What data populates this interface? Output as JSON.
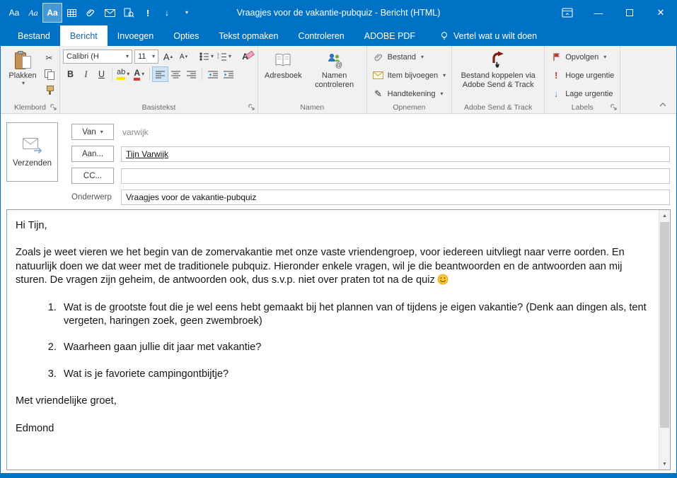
{
  "colors": {
    "accent": "#0072c6",
    "high_urgency_red": "#c0392b",
    "low_urgency_blue": "#2b7cd3",
    "highlight_yellow": "#ffe114",
    "font_color_red": "#d83b2d"
  },
  "titlebar": {
    "title": "Vraagjes voor de vakantie-pubquiz - Bericht (HTML)",
    "qat_aa": [
      "Aa",
      "Aa",
      "Aa"
    ]
  },
  "icons": {
    "dropdown": "▾",
    "up_triangle": "▴",
    "down_triangle": "▾",
    "scissors": "✂",
    "pen": "✎",
    "high": "!",
    "low": "↓",
    "minimize": "—",
    "close": "✕",
    "scroll_up": "▲",
    "scroll_down": "▼",
    "emoji": "😊"
  },
  "tabs": {
    "file": "Bestand",
    "items": [
      "Bericht",
      "Invoegen",
      "Opties",
      "Tekst opmaken",
      "Controleren",
      "ADOBE PDF"
    ],
    "active": "Bericht",
    "tellme": "Vertel wat u wilt doen"
  },
  "ribbon": {
    "clipboard": {
      "paste": "Plakken",
      "group": "Klembord"
    },
    "basic_text": {
      "font_name": "Calibri (H",
      "font_size": "11",
      "grow": "A",
      "shrink": "A",
      "bold": "B",
      "italic": "I",
      "underline": "U",
      "highlight": "ab",
      "font_color": "A",
      "clear": "A",
      "group": "Basistekst"
    },
    "names": {
      "address_book": "Adresboek",
      "check_names": "Namen controleren",
      "group": "Namen"
    },
    "include": {
      "attach_file": "Bestand",
      "attach_item": "Item bijvoegen",
      "signature": "Handtekening",
      "group": "Opnemen"
    },
    "adobe": {
      "button": "Bestand koppelen via Adobe Send & Track",
      "group": "Adobe Send & Track"
    },
    "tags": {
      "follow_up": "Opvolgen",
      "high": "Hoge urgentie",
      "low": "Lage urgentie",
      "group": "Labels"
    }
  },
  "header": {
    "send": "Verzenden",
    "from_button": "Van",
    "from_value": "varwijk",
    "to_button": "Aan...",
    "to_value": "Tijn Varwijk",
    "cc_button": "CC...",
    "cc_value": "",
    "subject_label": "Onderwerp",
    "subject_value": "Vraagjes voor de vakantie-pubquiz"
  },
  "message": {
    "greeting": "Hi Tijn,",
    "para1": "Zoals je weet vieren we het begin van de zomervakantie met onze vaste vriendengroep, voor iedereen uitvliegt naar verre oorden. En natuurlijk doen we dat weer met de traditionele pubquiz.  Hieronder enkele vragen, wil je die beantwoorden en de antwoorden aan mij sturen. De vragen zijn geheim, de antwoorden ook, dus s.v.p. niet over praten tot na de quiz",
    "questions": [
      "Wat is de grootste fout die je wel eens hebt gemaakt bij het plannen van of tijdens je eigen vakantie? (Denk aan dingen als, tent vergeten, haringen zoek, geen zwembroek)",
      "Waarheen gaan jullie dit jaar met vakantie?",
      "Wat is je favoriete campingontbijtje?"
    ],
    "closing": "Met vriendelijke groet,",
    "signature": "Edmond"
  }
}
